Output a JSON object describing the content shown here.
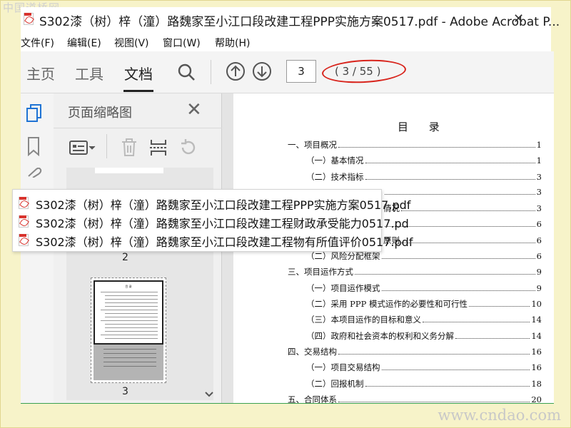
{
  "watermark": {
    "top": "中国道桥网",
    "bottom": "www.cndao.com"
  },
  "window": {
    "title": "S302漆（树）梓（潼）路魏家至小江口段改建工程PPP实施方案0517.pdf - Adobe Acrobat P...",
    "close_glyph": "✕"
  },
  "menu": [
    "文件(F)",
    "编辑(E)",
    "视图(V)",
    "窗口(W)",
    "帮助(H)"
  ],
  "toolbar": {
    "tabs": [
      "主页",
      "工具",
      "文档"
    ],
    "active_tab": "文档",
    "current_page": "3",
    "page_count": "( 3 / 55 )",
    "highlight_color": "#d8241c"
  },
  "panel": {
    "title": "页面缩略图",
    "thumb_labels": [
      "2",
      "3"
    ],
    "thumb3_heading": "目 录"
  },
  "document": {
    "heading": "目 录",
    "toc": [
      {
        "text": "一、项目概况",
        "page": "1",
        "level": 1,
        "visible": true
      },
      {
        "text": "（一）基本情况",
        "page": "1",
        "level": 2,
        "visible": true
      },
      {
        "text": "（二）技术指标",
        "page": "3",
        "level": 2,
        "visible": true
      },
      {
        "text": "",
        "page": "3",
        "level": 2,
        "visible": false
      },
      {
        "text": "情况",
        "page": "3",
        "level": 2,
        "visible": true
      },
      {
        "text": "",
        "page": "6",
        "level": 2,
        "visible": false
      },
      {
        "text": "原则",
        "page": "6",
        "level": 2,
        "visible": true
      },
      {
        "text": "（二）风险分配框架",
        "page": "6",
        "level": 2,
        "visible": true
      },
      {
        "text": "三、项目运作方式",
        "page": "9",
        "level": 1,
        "visible": true
      },
      {
        "text": "（一）项目运作模式",
        "page": "9",
        "level": 2,
        "visible": true
      },
      {
        "text": "（二）采用 PPP 模式运作的必要性和可行性",
        "page": "10",
        "level": 2,
        "visible": true
      },
      {
        "text": "（三）本项目运作的目标和意义",
        "page": "14",
        "level": 2,
        "visible": true
      },
      {
        "text": "（四）政府和社会资本的权利和义务分解",
        "page": "14",
        "level": 2,
        "visible": true
      },
      {
        "text": "四、交易结构",
        "page": "16",
        "level": 1,
        "visible": true
      },
      {
        "text": "（一）项目交易结构",
        "page": "16",
        "level": 2,
        "visible": true
      },
      {
        "text": "（二）回报机制",
        "page": "18",
        "level": 2,
        "visible": true
      },
      {
        "text": "五、合同体系",
        "page": "20",
        "level": 1,
        "visible": true
      }
    ]
  },
  "popup": {
    "files": [
      "S302漆（树）梓（潼）路魏家至小江口段改建工程PPP实施方案0517.pdf",
      "S302漆（树）梓（潼）路魏家至小江口段改建工程财政承受能力0517.pd",
      "S302漆（树）梓（潼）路魏家至小江口段改建工程物有所值评价0517.pdf"
    ]
  }
}
